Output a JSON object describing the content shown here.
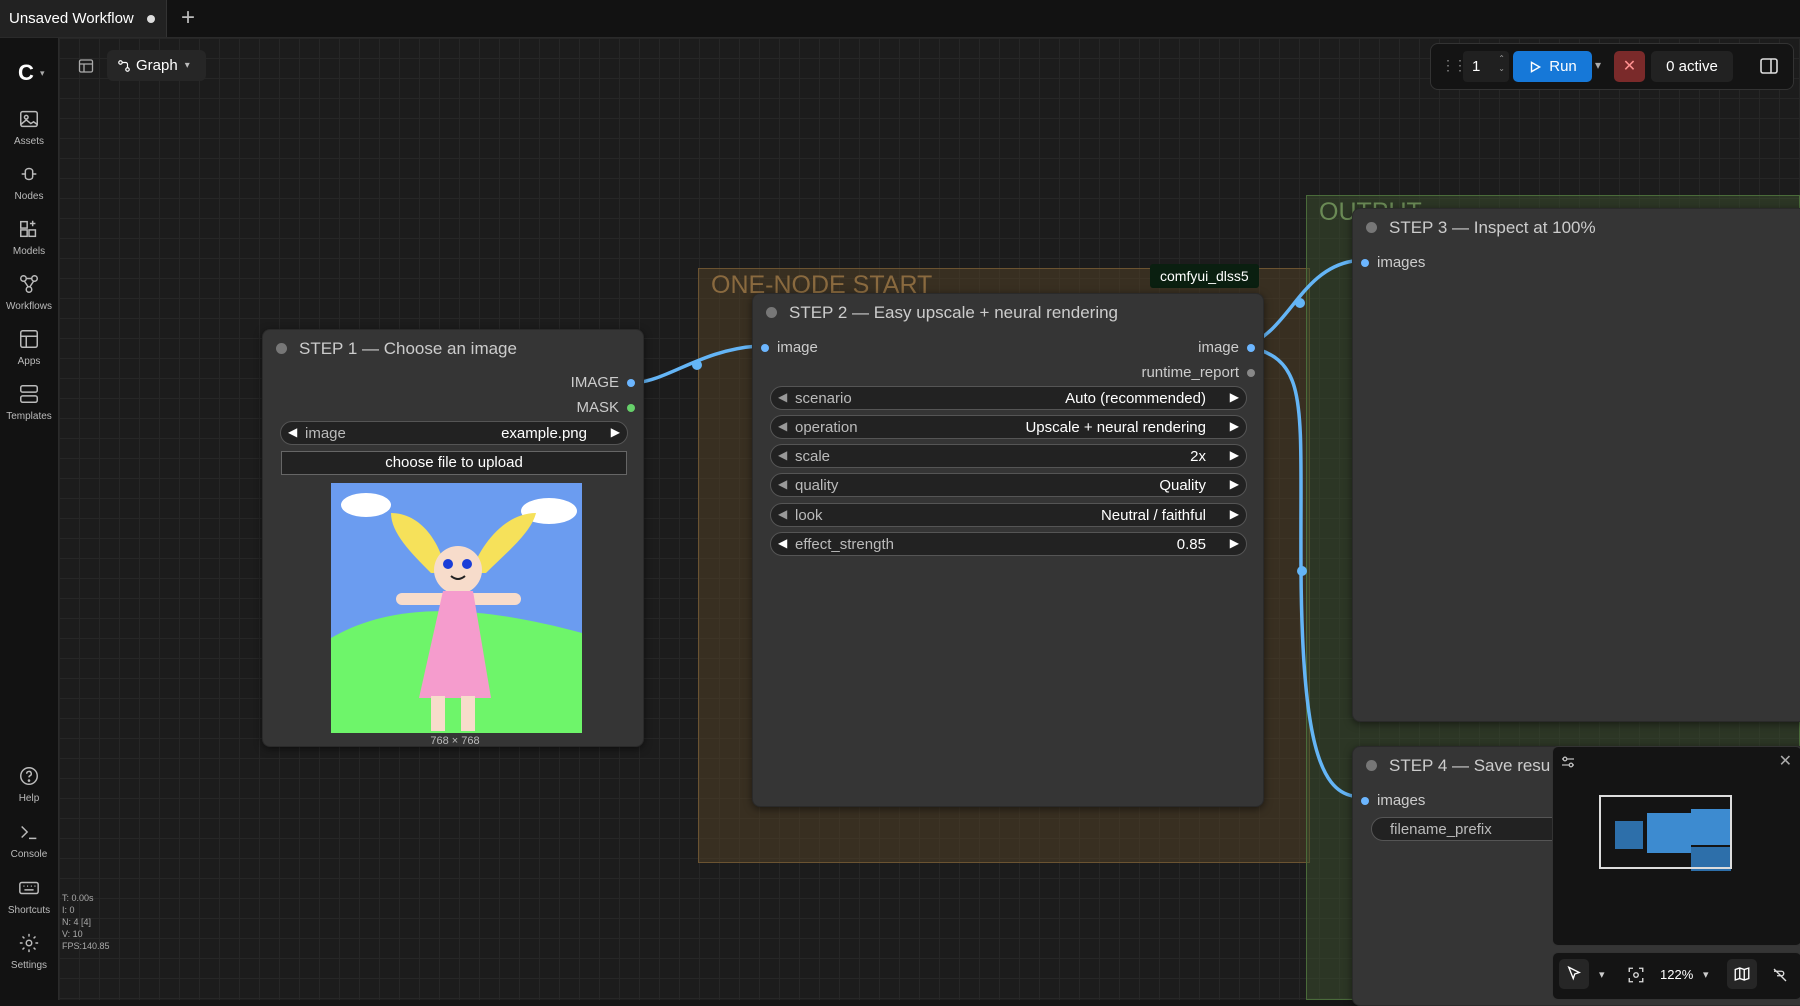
{
  "tab": {
    "title": "Unsaved Workflow",
    "add_label": "+"
  },
  "sidebar": {
    "items": [
      {
        "label": "Assets",
        "icon": "image-icon"
      },
      {
        "label": "Nodes",
        "icon": "nodes-icon"
      },
      {
        "label": "Models",
        "icon": "models-icon"
      },
      {
        "label": "Workflows",
        "icon": "workflows-icon"
      },
      {
        "label": "Apps",
        "icon": "apps-icon"
      },
      {
        "label": "Templates",
        "icon": "templates-icon"
      }
    ],
    "bottom_items": [
      {
        "label": "Help",
        "icon": "help-icon"
      },
      {
        "label": "Console",
        "icon": "console-icon"
      },
      {
        "label": "Shortcuts",
        "icon": "keyboard-icon"
      },
      {
        "label": "Settings",
        "icon": "gear-icon"
      }
    ]
  },
  "toolbar": {
    "graph_label": "Graph"
  },
  "runbar": {
    "queue_count": "1",
    "run_label": "Run",
    "active_label": "0 active",
    "stop_symbol": "✕"
  },
  "groups": {
    "one_node": {
      "title": "ONE-NODE START",
      "color": "#6b5331",
      "bg": "#4a3b28"
    },
    "output": {
      "title": "OUTPUT",
      "color": "#4a6b3a",
      "bg": "#2f3e28"
    }
  },
  "tag": {
    "label": "comfyui_dlss5"
  },
  "step1": {
    "title": "STEP 1 — Choose an image",
    "outputs": [
      "IMAGE",
      "MASK"
    ],
    "widget": {
      "name": "image",
      "value": "example.png"
    },
    "upload_label": "choose file to upload",
    "dims": "768 × 768"
  },
  "step2": {
    "title": "STEP 2 — Easy upscale + neural rendering",
    "input": "image",
    "outputs": [
      "image",
      "runtime_report"
    ],
    "widgets": [
      {
        "name": "scenario",
        "value": "Auto (recommended)"
      },
      {
        "name": "operation",
        "value": "Upscale + neural rendering"
      },
      {
        "name": "scale",
        "value": "2x"
      },
      {
        "name": "quality",
        "value": "Quality"
      },
      {
        "name": "look",
        "value": "Neutral / faithful"
      },
      {
        "name": "effect_strength",
        "value": "0.85"
      }
    ]
  },
  "step3": {
    "title": "STEP 3 — Inspect at 100%",
    "input": "images"
  },
  "step4": {
    "title": "STEP 4 — Save resu",
    "input": "images",
    "widget": {
      "name": "filename_prefix"
    }
  },
  "zoom": {
    "level": "122%"
  },
  "stats": {
    "lines": [
      "T: 0.00s",
      "I: 0",
      "N: 4 [4]",
      "V: 10",
      "FPS:140.85"
    ]
  },
  "colors": {
    "accent": "#1678d8",
    "link": "#64b5f6"
  }
}
